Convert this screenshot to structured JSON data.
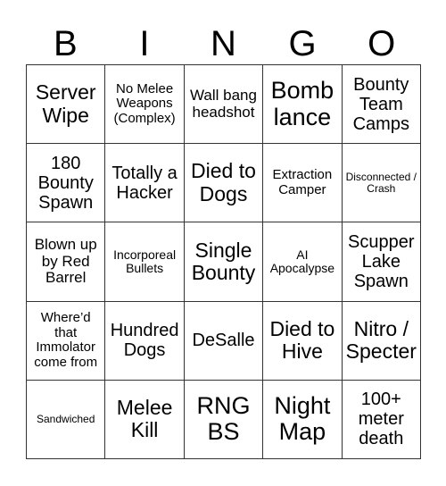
{
  "header": {
    "letters": [
      "B",
      "I",
      "N",
      "G",
      "O"
    ]
  },
  "cells": [
    [
      "Server Wipe",
      "No Melee Weapons (Complex)",
      "Wall bang headshot",
      "Bomb lance",
      "Bounty Team Camps"
    ],
    [
      "180 Bounty Spawn",
      "Totally a Hacker",
      "Died to Dogs",
      "Extraction Camper",
      "Disconnected / Crash"
    ],
    [
      "Blown up by Red Barrel",
      "Incorporeal Bullets",
      "Single Bounty",
      "AI Apocalypse",
      "Scupper Lake Spawn"
    ],
    [
      "Where’d that Immolator come from",
      "Hundred Dogs",
      "DeSalle",
      "Died to Hive",
      "Nitro / Specter"
    ],
    [
      "Sandwiched",
      "Melee Kill",
      "RNG BS",
      "Night Map",
      "100+ meter death"
    ]
  ]
}
